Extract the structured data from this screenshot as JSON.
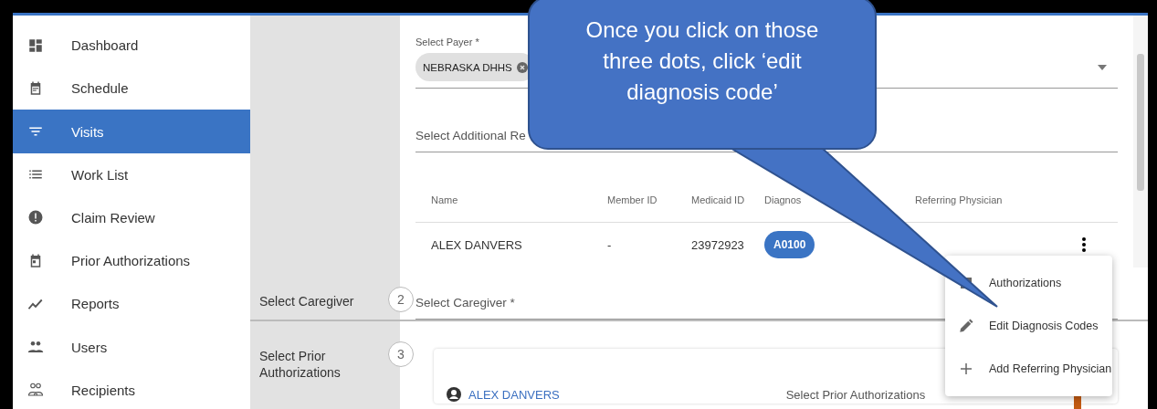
{
  "sidebar": {
    "items": [
      {
        "label": "Dashboard",
        "selected": false
      },
      {
        "label": "Schedule",
        "selected": false
      },
      {
        "label": "Visits",
        "selected": true
      },
      {
        "label": "Work List",
        "selected": false
      },
      {
        "label": "Claim Review",
        "selected": false
      },
      {
        "label": "Prior Authorizations",
        "selected": false
      },
      {
        "label": "Reports",
        "selected": false
      },
      {
        "label": "Users",
        "selected": false
      },
      {
        "label": "Recipients",
        "selected": false
      }
    ]
  },
  "payer_field": {
    "label": "Select Payer *",
    "chip": "NEBRASKA DHHS"
  },
  "additional_field": {
    "placeholder": "Select Additional Re"
  },
  "table": {
    "columns": [
      "Name",
      "Member ID",
      "Medicaid ID",
      "Diagnos",
      "Referring Physician"
    ],
    "rows": [
      {
        "name": "ALEX DANVERS",
        "member_id": "-",
        "medicaid_id": "23972923",
        "code": "A0100"
      }
    ]
  },
  "sections": [
    {
      "kind": "field",
      "label": "Select Caregiver",
      "step": "2",
      "placeholder": "Select Caregiver *"
    },
    {
      "kind": "card",
      "label": "Select Prior Authorizations",
      "step": "3",
      "link": "ALEX DANVERS",
      "text": "Select Prior Authorizations"
    }
  ],
  "menu": {
    "items": [
      {
        "label": "Authorizations"
      },
      {
        "label": "Edit Diagnosis Codes"
      },
      {
        "label": "Add Referring Physician"
      }
    ]
  },
  "callout": {
    "text": "Once you click on those three dots, click ‘edit diagnosis code’"
  }
}
